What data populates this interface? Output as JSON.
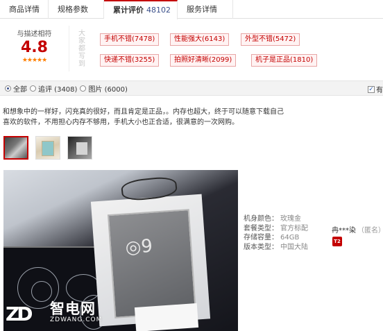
{
  "tabs": [
    {
      "label": "商品详情"
    },
    {
      "label": "规格参数"
    },
    {
      "label": "累计评价",
      "count": "48102"
    },
    {
      "label": "服务详情"
    }
  ],
  "rating": {
    "label": "与描述相符",
    "score": "4.8",
    "stars": "★★★★★",
    "tags_title": "大家都写到",
    "tags": [
      {
        "label": "手机不错(7478)"
      },
      {
        "label": "性能强大(6143)"
      },
      {
        "label": "外型不错(5472)"
      },
      {
        "label": "快递不错(3255)"
      },
      {
        "label": "拍照好清晰(2099)"
      },
      {
        "label": "机子是正品(1810)"
      }
    ]
  },
  "filter": {
    "options": [
      {
        "label": "全部",
        "selected": true
      },
      {
        "label": "追评 (3408)",
        "selected": false
      },
      {
        "label": "图片 (6000)",
        "selected": false
      }
    ],
    "checkbox_label": "有"
  },
  "review": {
    "line1": "和想象中的一样好，闪充真的很好，而且肯定是正品，。内存也超大，终于可以随意下载自己",
    "line2": "喜欢的软件，不用担心内存不够用，手机大小也正合适，很满意的一次网购。"
  },
  "sku": [
    {
      "key": "机身颜色：",
      "value": "玫瑰金"
    },
    {
      "key": "套餐类型：",
      "value": "官方标配"
    },
    {
      "key": "存储容量：",
      "value": "64GB"
    },
    {
      "key": "版本类型：",
      "value": "中国大陆"
    }
  ],
  "reviewer": {
    "name": "冉***染",
    "anon": "（匿名）",
    "badge": "T2"
  },
  "watermark": {
    "logo": "ZD",
    "cn": "智电网",
    "en": "ZDWANG.COM"
  },
  "colors": {
    "accent": "#c40000",
    "tag_border": "#e8a5a5",
    "tag_bg": "#fff3f3",
    "link": "#3a4f8a"
  }
}
